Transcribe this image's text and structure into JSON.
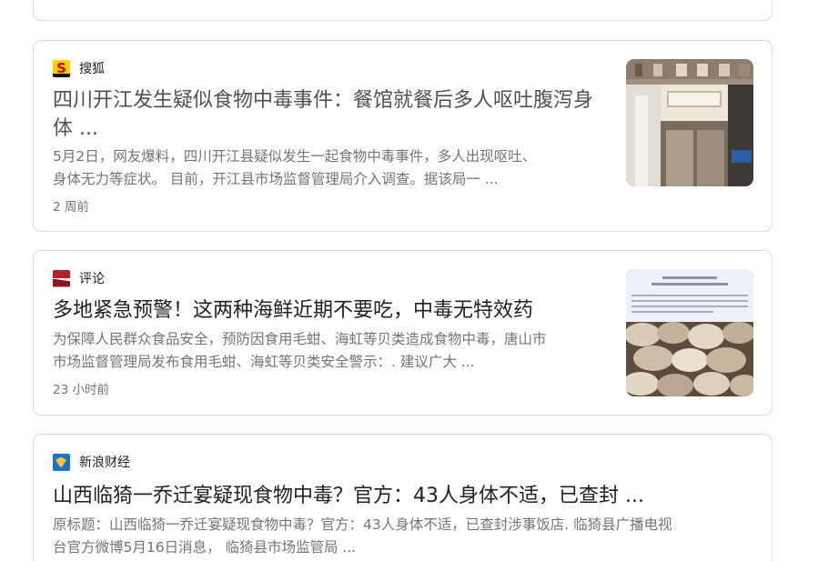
{
  "articles": [
    {
      "source": "搜狐",
      "source_icon": "sohu-logo-icon",
      "title_line1": "四川开江发生疑似食物中毒事件：餐馆就餐后多人呕吐腹泻身",
      "title_line2": "体 ...",
      "snippet_line1": "5月2日，网友爆料，四川开江县疑似发生一起食物中毒事件，多人出现呕吐、",
      "snippet_line2": "身体无力等症状。 目前，开江县市场监督管理局介入调查。据该局一 ...",
      "time": "2 周前"
    },
    {
      "source": "评论",
      "source_icon": "pinglun-logo-icon",
      "title_line1": "多地紧急预警！这两种海鲜近期不要吃，中毒无特效药",
      "snippet_line1": "为保障人民群众食品安全，预防因食用毛蚶、海虹等贝类造成食物中毒，唐山市",
      "snippet_line2": "市场监督管理局发布食用毛蚶、海虹等贝类安全警示：. 建议广大 ...",
      "time": "23 小时前"
    },
    {
      "source": "新浪财经",
      "source_icon": "sina-finance-logo-icon",
      "title_line1": "山西临猗一乔迁宴疑现食物中毒？官方：43人身体不适，已查封 ...",
      "snippet_line1": "原标题：山西临猗一乔迁宴疑现食物中毒？官方：43人身体不适，已查封涉事饭店. 临猗县广播电视",
      "snippet_line2": "台官方微博5月16日消息， 临猗县市场监管局 ..."
    }
  ]
}
